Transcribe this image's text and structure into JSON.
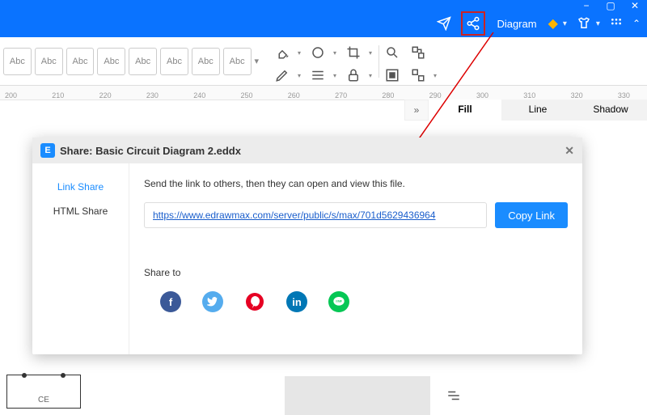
{
  "titlebar": {
    "diagram_label": "Diagram"
  },
  "ribbon": {
    "abc_label": "Abc"
  },
  "ruler": {
    "marks": [
      "200",
      "210",
      "220",
      "230",
      "240",
      "250",
      "260",
      "270",
      "280",
      "290",
      "300",
      "310",
      "320",
      "330"
    ]
  },
  "right_tabs": {
    "fill": "Fill",
    "line": "Line",
    "shadow": "Shadow"
  },
  "dialog": {
    "title": "Share: Basic Circuit Diagram 2.eddx",
    "side": {
      "link": "Link Share",
      "html": "HTML Share"
    },
    "instruction": "Send the link to others, then they can open and view this file.",
    "url": "https://www.edrawmax.com/server/public/s/max/701d5629436964",
    "copy": "Copy Link",
    "share_to": "Share to"
  },
  "footer_shape_label": "CE"
}
